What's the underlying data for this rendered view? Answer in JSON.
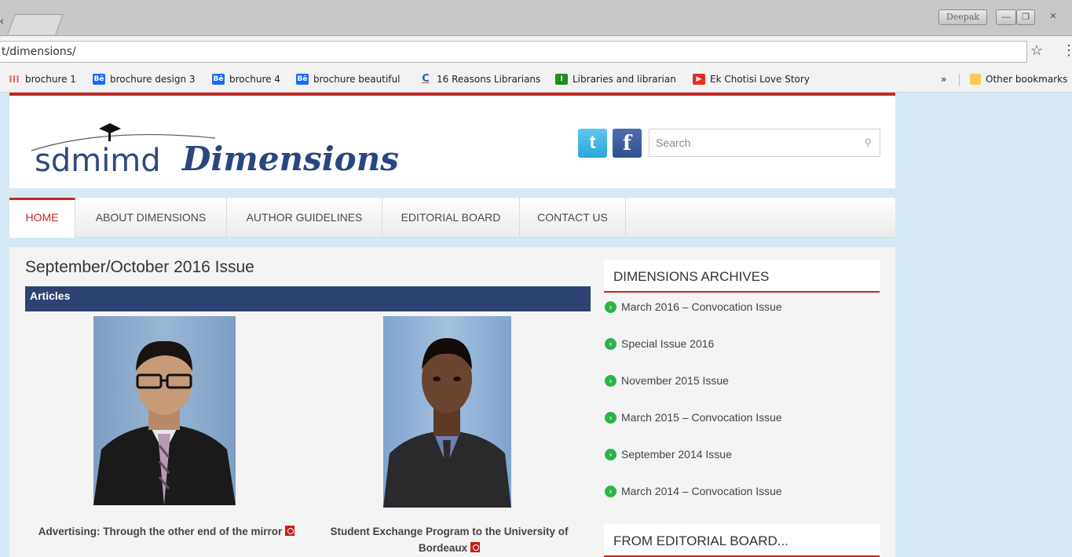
{
  "browser": {
    "back_glyph": "‹",
    "user_badge": "Deepak",
    "minimize_glyph": "—",
    "maximize_glyph": "❐",
    "close_glyph": "✕",
    "url": "t/dimensions/",
    "star_glyph": "☆",
    "menu_glyph": "⋮",
    "bookmarks": [
      {
        "label": "brochure 1",
        "icon": "apps-icon",
        "glyph": "⁞⁞⁞"
      },
      {
        "label": "brochure design 3",
        "icon": "behance-icon",
        "glyph": "Bē"
      },
      {
        "label": "brochure 4",
        "icon": "behance-icon",
        "glyph": "Bē"
      },
      {
        "label": "brochure beautiful",
        "icon": "behance-icon",
        "glyph": "Bē"
      },
      {
        "label": "16 Reasons Librarians",
        "icon": "c-site-icon",
        "glyph": "C"
      },
      {
        "label": "Libraries and librarian",
        "icon": "library-icon",
        "glyph": "I"
      },
      {
        "label": "Ek Chotisi Love Story",
        "icon": "youtube-icon",
        "glyph": "▶"
      }
    ],
    "overflow_glyph": "»",
    "other_bookmarks": "Other bookmarks"
  },
  "site": {
    "logo_sdmimd": "sdmimd",
    "logo_dimensions": "Dimensions",
    "twitter_glyph": "t",
    "facebook_glyph": "f",
    "search_placeholder": "Search",
    "search_glyph": "⚲"
  },
  "nav": {
    "items": [
      "HOME",
      "ABOUT DIMENSIONS",
      "AUTHOR GUIDELINES",
      "EDITORIAL BOARD",
      "CONTACT US"
    ],
    "active_index": 0
  },
  "main": {
    "issue_title": "September/October 2016 Issue",
    "section_label": "Articles",
    "articles": [
      {
        "title": "Advertising: Through the other end of the mirror"
      },
      {
        "title": "Student Exchange Program to the University of Bordeaux"
      }
    ]
  },
  "sidebar": {
    "archives_title": "DIMENSIONS ARCHIVES",
    "archive_arrow": "›",
    "archives": [
      "March 2016 – Convocation Issue",
      "Special Issue 2016",
      "November 2015 Issue",
      "March 2015 – Convocation Issue",
      "September 2014 Issue",
      "March 2014 – Convocation Issue"
    ],
    "editorial_title": "FROM EDITORIAL BOARD..."
  },
  "colors": {
    "accent_red": "#c62828",
    "articles_bar": "#2d4373",
    "page_bg": "#d6e9f5",
    "archive_icon": "#2db34a"
  }
}
